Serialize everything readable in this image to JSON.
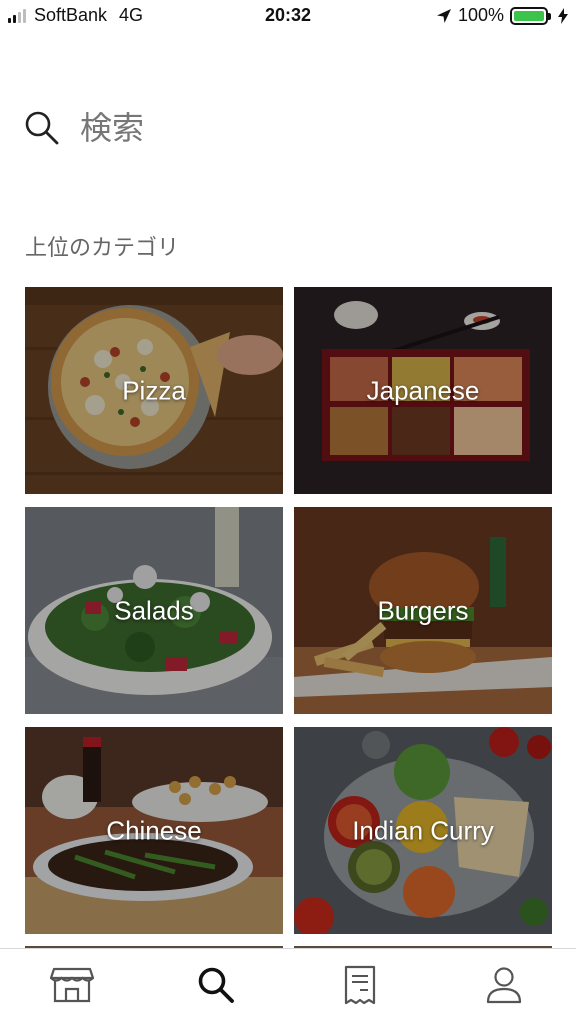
{
  "status_bar": {
    "carrier": "SoftBank",
    "network": "4G",
    "time": "20:32",
    "battery": "100%",
    "icons": [
      "signal-icon",
      "location-arrow-icon",
      "battery-icon",
      "charging-bolt-icon"
    ]
  },
  "search": {
    "placeholder": "検索",
    "icon": "search-icon"
  },
  "section": {
    "title": "上位のカテゴリ"
  },
  "categories": [
    {
      "label": "Pizza",
      "image": "pizza-photo"
    },
    {
      "label": "Japanese",
      "image": "bento-photo"
    },
    {
      "label": "Salads",
      "image": "salad-photo"
    },
    {
      "label": "Burgers",
      "image": "burger-photo"
    },
    {
      "label": "Chinese",
      "image": "chinese-food-photo"
    },
    {
      "label": "Indian Curry",
      "image": "indian-curry-photo"
    }
  ],
  "tabs": [
    {
      "name": "home",
      "icon": "store-icon",
      "active": false
    },
    {
      "name": "search",
      "icon": "search-icon",
      "active": true
    },
    {
      "name": "orders",
      "icon": "receipt-icon",
      "active": false
    },
    {
      "name": "account",
      "icon": "user-icon",
      "active": false
    }
  ],
  "colors": {
    "battery_fill": "#3cc34b",
    "inactive_tab_icon": "#555555",
    "active_tab_icon": "#111111",
    "section_title": "#666666"
  }
}
